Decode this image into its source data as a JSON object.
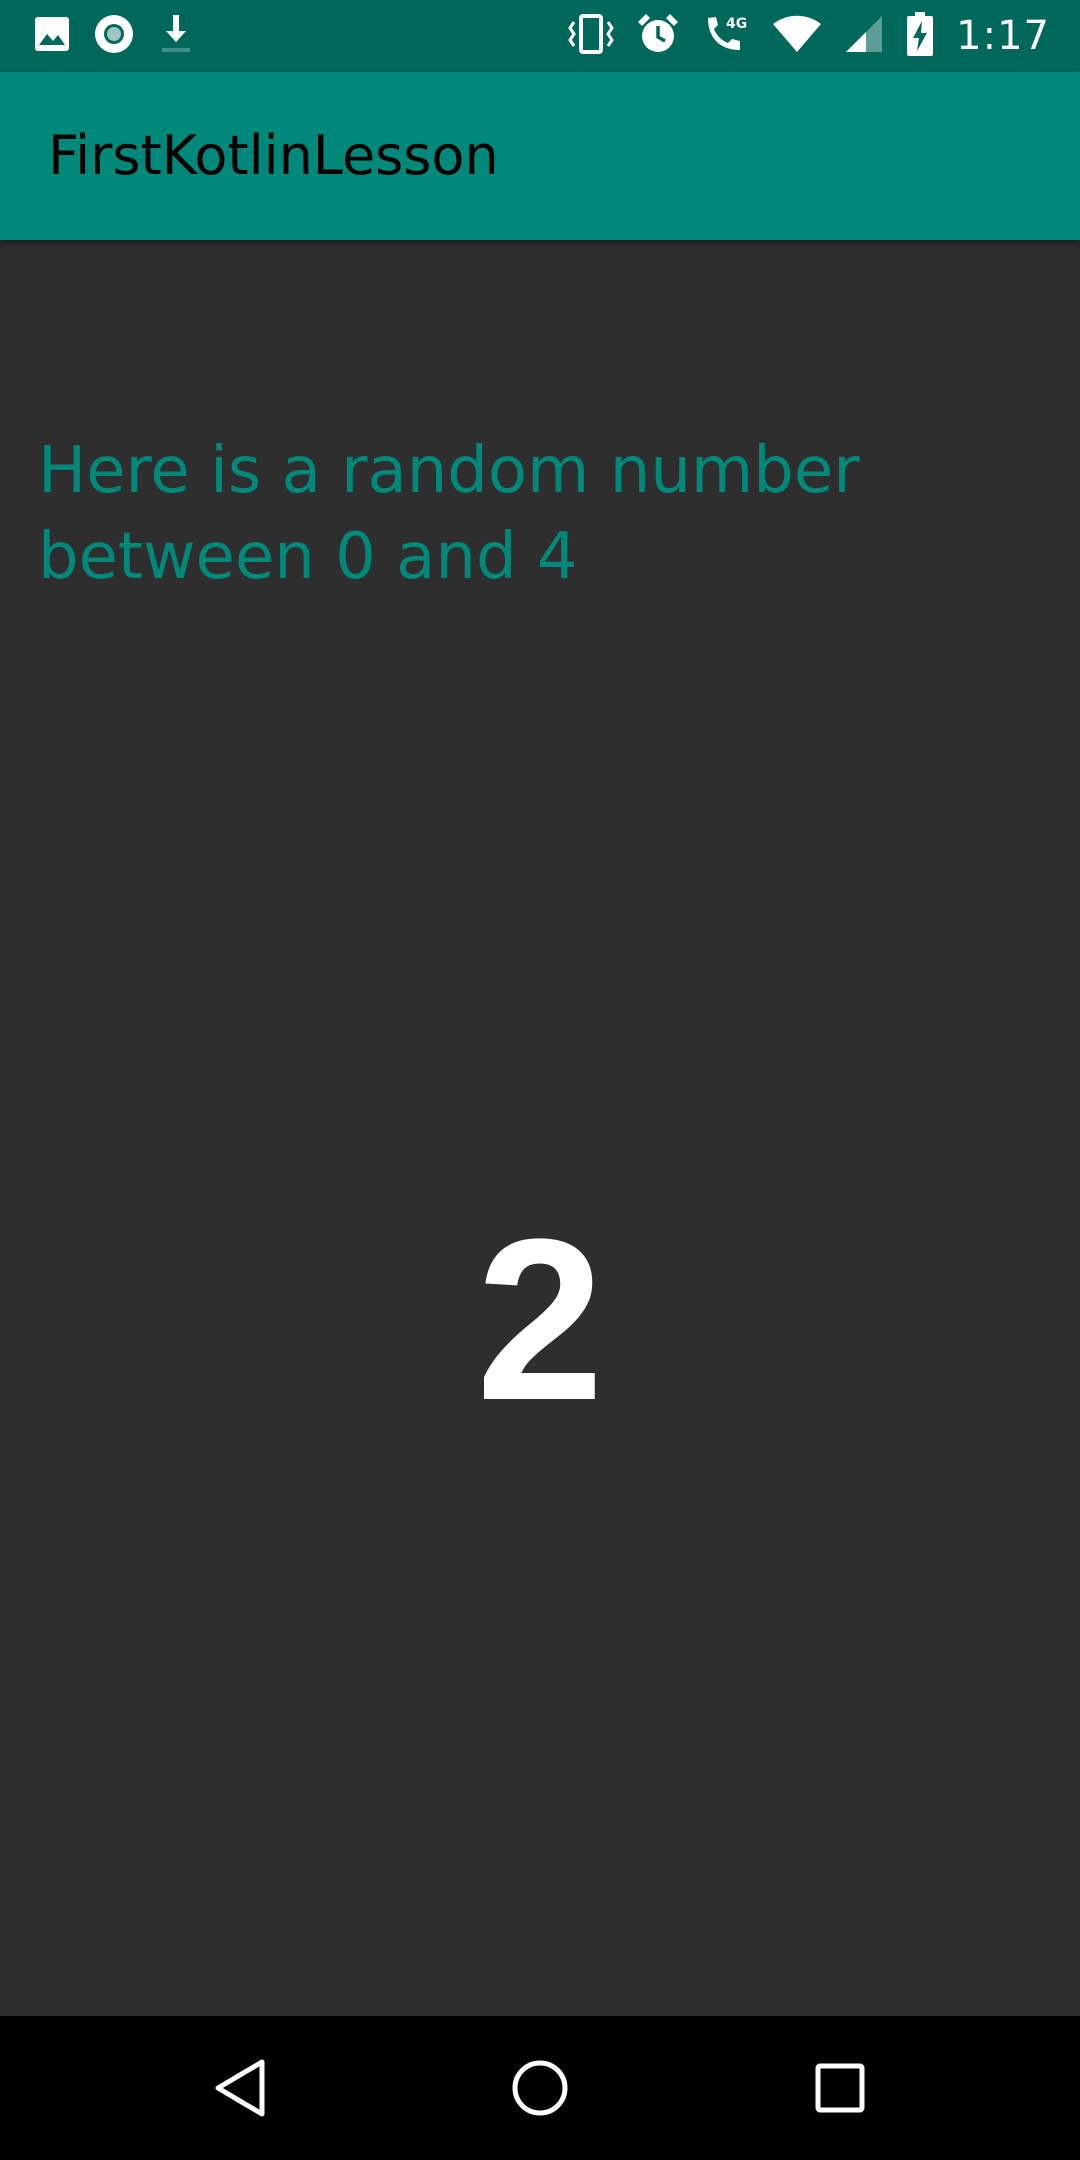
{
  "status_bar": {
    "time": "1:17",
    "network": "4G",
    "icons": [
      "image-icon",
      "circle-record-icon",
      "download-icon",
      "vibrate-icon",
      "alarm-icon",
      "wifi-call-icon",
      "wifi-icon",
      "cellular-signal-icon",
      "battery-charging-icon"
    ]
  },
  "app_bar": {
    "title": "FirstKotlinLesson"
  },
  "main": {
    "prompt": "Here is a random number between 0 and 4",
    "number": "2"
  },
  "nav_bar": {
    "buttons": [
      "back-icon",
      "home-icon",
      "recents-icon"
    ]
  },
  "colors": {
    "status_bar": "#00675b",
    "app_bar": "#00887a",
    "accent_text": "#00887a",
    "background": "#2e2e2e",
    "number": "#ffffff",
    "nav_bar": "#000000"
  }
}
